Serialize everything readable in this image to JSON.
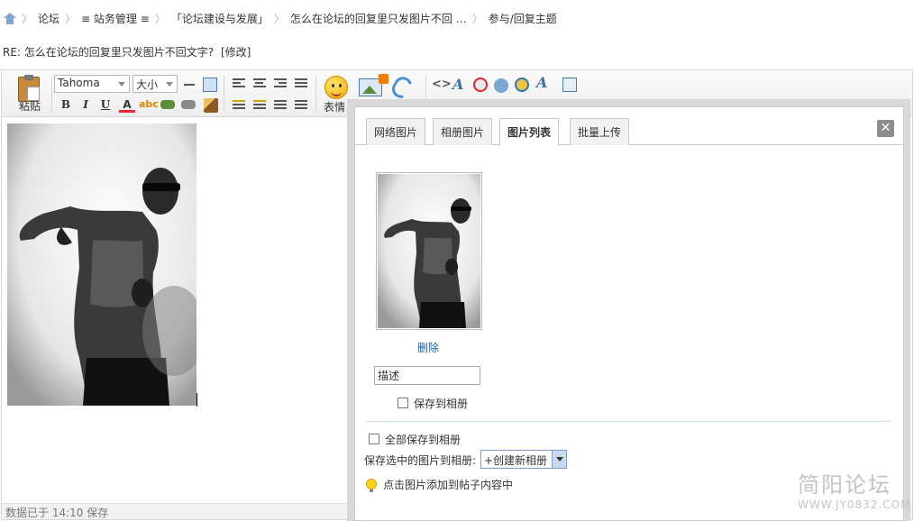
{
  "breadcrumb": {
    "items": [
      "论坛",
      "≡ 站务管理 ≡",
      "「论坛建设与发展」",
      "怎么在论坛的回复里只发图片不回 …",
      "参与/回复主题"
    ]
  },
  "thread": {
    "title": "RE: 怎么在论坛的回复里只发图片不回文字?",
    "edit_label": "[修改]"
  },
  "toolbar": {
    "paste_label": "粘贴",
    "font_value": "Tahoma",
    "size_value": "大小",
    "emoticon_label": "表情",
    "image_label": "图片",
    "attachment_label": "附件"
  },
  "status": {
    "text": "数据已于  14:10 保存"
  },
  "dialog": {
    "tabs": [
      {
        "label": "网络图片",
        "active": false
      },
      {
        "label": "相册图片",
        "active": false
      },
      {
        "label": "图片列表",
        "active": true
      },
      {
        "label": "批量上传",
        "active": false
      }
    ],
    "close_symbol": "✕",
    "delete_label": "删除",
    "description_value": "描述",
    "save_to_album_label": "保存到相册",
    "save_all_label": "全部保存到相册",
    "save_selected_label": "保存选中的图片到相册:",
    "album_option": "+创建新相册",
    "hint": "点击图片添加到帖子内容中"
  },
  "watermark": {
    "title": "简阳论坛",
    "url": "WWW.JY0832.COM"
  },
  "colors": {
    "link": "#1c5fa8",
    "toolbar_bg": "#eeeeee",
    "dialog_border": "#c9c9c9"
  }
}
